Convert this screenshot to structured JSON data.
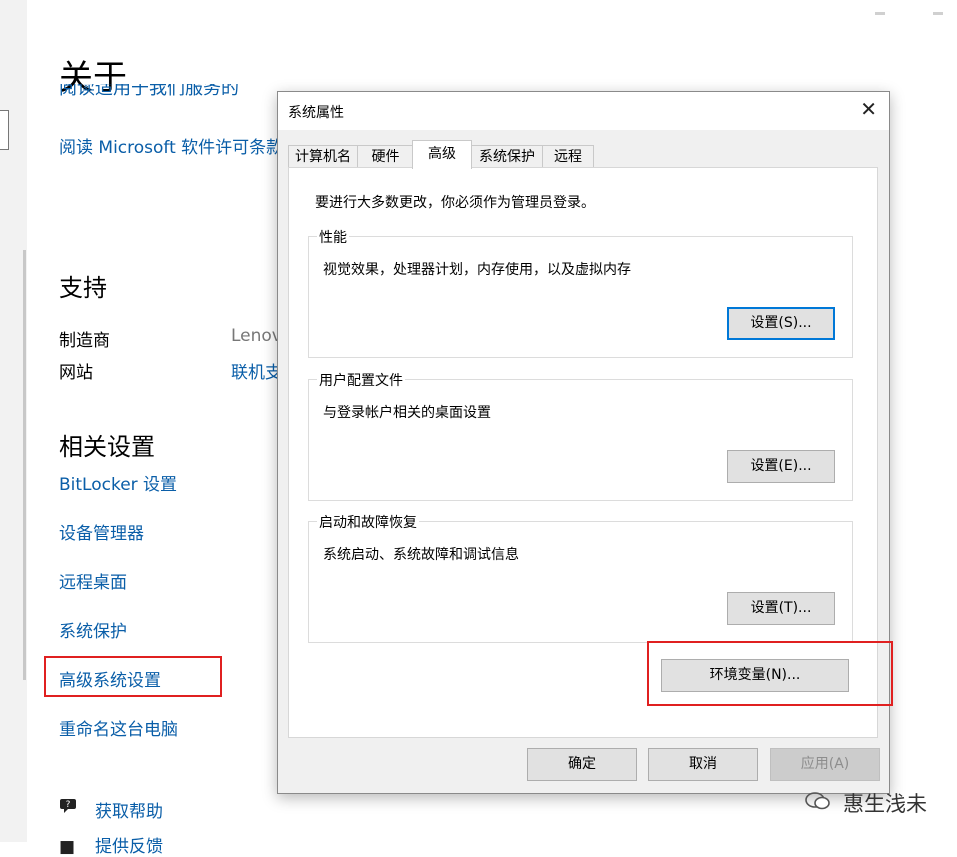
{
  "settings": {
    "title": "关于",
    "clipped_link": "阅读适用于我们服务的",
    "license_link": "阅读 Microsoft 软件许可条款",
    "support_heading": "支持",
    "manufacturer_label": "制造商",
    "manufacturer_value": "Lenovo",
    "website_label": "网站",
    "website_value": "联机支持",
    "related_heading": "相关设置",
    "related_links": [
      "BitLocker 设置",
      "设备管理器",
      "远程桌面",
      "系统保护",
      "高级系统设置",
      "重命名这台电脑"
    ],
    "help_link": "获取帮助",
    "feedback_link": "提供反馈"
  },
  "dialog": {
    "title": "系统属性",
    "close": "✕",
    "tabs": [
      "计算机名",
      "硬件",
      "高级",
      "系统保护",
      "远程"
    ],
    "active_tab": "高级",
    "intro": "要进行大多数更改，你必须作为管理员登录。",
    "performance": {
      "legend": "性能",
      "desc": "视觉效果，处理器计划，内存使用，以及虚拟内存",
      "button": "设置(S)..."
    },
    "profiles": {
      "legend": "用户配置文件",
      "desc": "与登录帐户相关的桌面设置",
      "button": "设置(E)..."
    },
    "startup": {
      "legend": "启动和故障恢复",
      "desc": "系统启动、系统故障和调试信息",
      "button": "设置(T)..."
    },
    "env_button": "环境变量(N)...",
    "ok_button": "确定",
    "cancel_button": "取消",
    "apply_button": "应用(A)"
  },
  "watermark": "惠生浅未",
  "icons": {
    "help": "help-icon",
    "wechat": "wechat-icon",
    "close": "close-icon"
  },
  "colors": {
    "link": "#0a5ea8",
    "highlight": "#e02020",
    "focus": "#0078d7"
  }
}
